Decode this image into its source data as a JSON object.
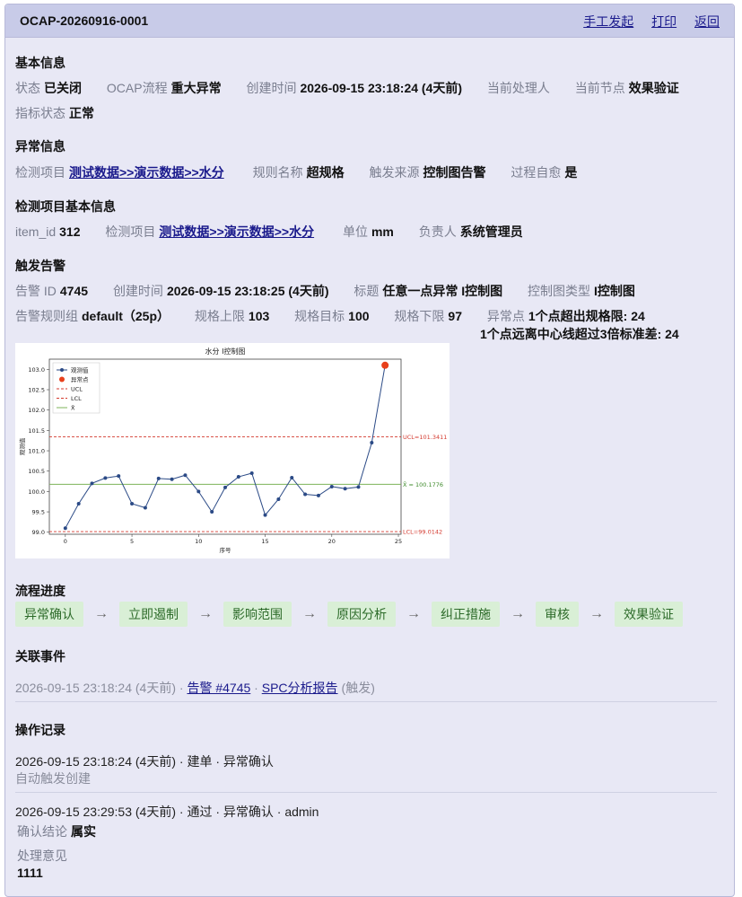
{
  "header": {
    "title": "OCAP-20260916-0001",
    "links": [
      "手工发起",
      "打印",
      "返回"
    ]
  },
  "basic": {
    "title": "基本信息",
    "status_label": "状态",
    "status": "已关闭",
    "flow_label": "OCAP流程",
    "flow": "重大异常",
    "created_label": "创建时间",
    "created": "2026-09-15 23:18:24 (4天前)",
    "handler_label": "当前处理人",
    "handler": "",
    "node_label": "当前节点",
    "node": "效果验证",
    "metric_label": "指标状态",
    "metric": "正常"
  },
  "abnormal": {
    "title": "异常信息",
    "item_label": "检测项目",
    "item": "测试数据>>演示数据>>水分",
    "rule_label": "规则名称",
    "rule": "超规格",
    "source_label": "触发来源",
    "source": "控制图告警",
    "self_label": "过程自愈",
    "self": "是"
  },
  "itembase": {
    "title": "检测项目基本信息",
    "id_label": "item_id",
    "id": "312",
    "item_label": "检测项目",
    "item": "测试数据>>演示数据>>水分",
    "unit_label": "单位",
    "unit": "mm",
    "owner_label": "负责人",
    "owner": "系统管理员"
  },
  "alarm": {
    "title": "触发告警",
    "id_label": "告警 ID",
    "id": "4745",
    "created_label": "创建时间",
    "created": "2026-09-15 23:18:25 (4天前)",
    "subject_label": "标题",
    "subject": "任意一点异常 I控制图",
    "ctype_label": "控制图类型",
    "ctype": "I控制图",
    "group_label": "告警规则组",
    "group": "default（25p）",
    "usl_label": "规格上限",
    "usl": "103",
    "target_label": "规格目标",
    "target": "100",
    "lsl_label": "规格下限",
    "lsl": "97",
    "abn_label": "异常点",
    "abn1": "1个点超出规格限: 24",
    "abn2": "1个点远离中心线超过3倍标准差: 24"
  },
  "chart_data": {
    "type": "line",
    "title": "水分 I控制图",
    "xlabel": "序号",
    "ylabel": "观测值",
    "x": [
      0,
      1,
      2,
      3,
      4,
      5,
      6,
      7,
      8,
      9,
      10,
      11,
      12,
      13,
      14,
      15,
      16,
      17,
      18,
      19,
      20,
      21,
      22,
      23,
      24
    ],
    "series": [
      {
        "name": "观测值",
        "values": [
          99.1,
          99.7,
          100.2,
          100.33,
          100.38,
          99.7,
          99.6,
          100.32,
          100.3,
          100.4,
          100.0,
          99.5,
          100.1,
          100.36,
          100.45,
          99.42,
          99.81,
          100.34,
          99.93,
          99.9,
          100.12,
          100.07,
          100.11,
          101.2,
          103.1
        ]
      }
    ],
    "outliers": {
      "name": "异常点",
      "x": [
        24
      ],
      "y": [
        103.1
      ]
    },
    "ucl": 101.3411,
    "lcl": 99.0142,
    "center": 100.1776,
    "ucl_text": "UCL=101.3411",
    "lcl_text": "LCL=99.0142",
    "center_text": "X̄ = 100.1776",
    "legend": [
      "观测值",
      "异常点",
      "UCL",
      "LCL",
      "X̄"
    ],
    "xticks": [
      0,
      5,
      10,
      15,
      20,
      25
    ],
    "yticks": [
      "99.0",
      "99.5",
      "100.0",
      "100.5",
      "101.0",
      "101.5",
      "102.0",
      "102.5",
      "103.0"
    ],
    "ylim": [
      98.95,
      103.25
    ],
    "xlim": [
      -1.2,
      25.2
    ],
    "legend_position": "top-left",
    "colors": {
      "line": "#2b4a86",
      "outlier": "#e8401c",
      "limit": "#d43a2f",
      "center": "#7db35a"
    }
  },
  "flow": {
    "title": "流程进度",
    "steps": [
      "异常确认",
      "立即遏制",
      "影响范围",
      "原因分析",
      "纠正措施",
      "审核",
      "效果验证"
    ]
  },
  "related": {
    "title": "关联事件",
    "time": "2026-09-15 23:18:24 (4天前)",
    "link1": "告警 #4745",
    "link2": "SPC分析报告",
    "tag": "(触发)"
  },
  "ops": {
    "title": "操作记录",
    "r1_line": "2026-09-15 23:18:24 (4天前) · 建单 · 异常确认",
    "r1_note": "自动触发创建",
    "r2_line": "2026-09-15 23:29:53 (4天前) · 通过 · 异常确认 · admin",
    "r2_conc_label": "确认结论",
    "r2_conc": "属实",
    "r2_op_label": "处理意见",
    "r2_op": "1111"
  }
}
